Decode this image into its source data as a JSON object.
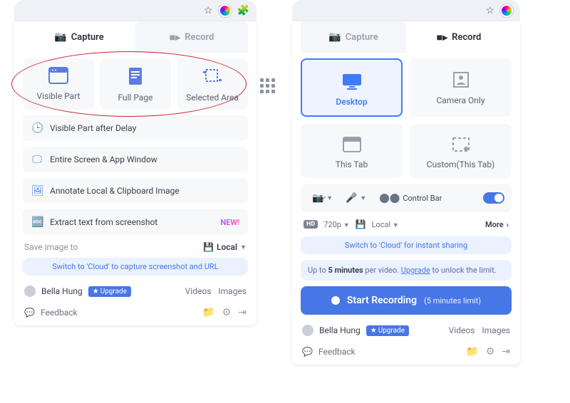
{
  "left": {
    "tabs": {
      "capture": "Capture",
      "record": "Record"
    },
    "options": {
      "visible_part": "Visible Part",
      "full_page": "Full Page",
      "selected_area": "Selected Area"
    },
    "rows": {
      "delay": "Visible Part after Delay",
      "entire": "Entire Screen & App Window",
      "annotate": "Annotate Local & Clipboard Image",
      "extract": "Extract text from screenshot",
      "new": "NEW!"
    },
    "save": {
      "label": "Save image to",
      "dest": "Local"
    },
    "cloud": "Switch to 'Cloud' to capture screenshot and URL",
    "user": {
      "name": "Bella Hung",
      "upgrade": "Upgrade",
      "videos": "Videos",
      "images": "Images"
    },
    "feedback": "Feedback"
  },
  "right": {
    "tabs": {
      "capture": "Capture",
      "record": "Record"
    },
    "modes": {
      "desktop": "Desktop",
      "camera": "Camera Only",
      "thistab": "This Tab",
      "custom": "Custom(This Tab)"
    },
    "controlbar": "Control Bar",
    "quality": "720p",
    "dest": "Local",
    "more": "More",
    "cloud": "Switch to 'Cloud' for instant sharing",
    "warn_pre": "Up to ",
    "warn_bold": "5 minutes",
    "warn_mid": " per video. ",
    "warn_link": "Upgrade",
    "warn_post": " to unlock the limit.",
    "start": "Start Recording",
    "start_sub": "(5 minutes limit)",
    "user": {
      "name": "Bella Hung",
      "upgrade": "Upgrade",
      "videos": "Videos",
      "images": "Images"
    },
    "feedback": "Feedback"
  }
}
